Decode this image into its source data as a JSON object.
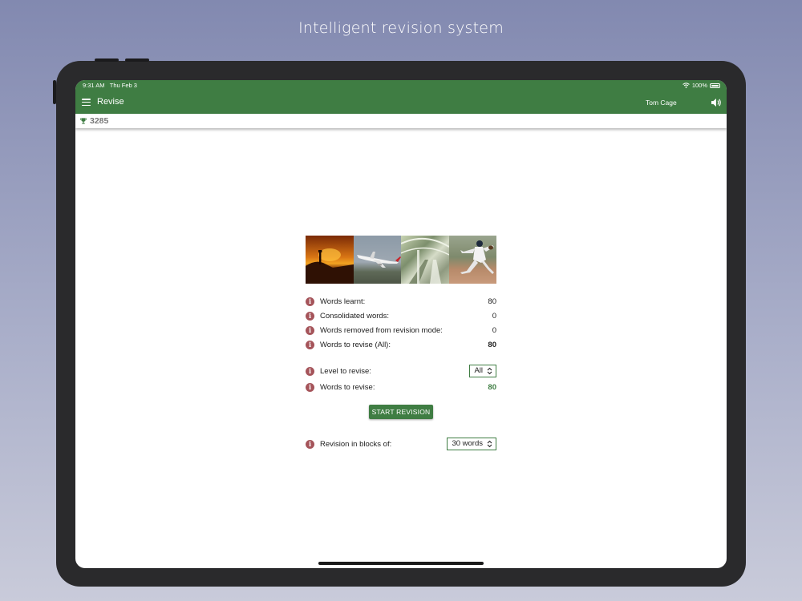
{
  "headline": "Intelligent revision system",
  "status_bar": {
    "time": "9:31 AM",
    "date": "Thu Feb 3",
    "battery": "100%"
  },
  "app_bar": {
    "title": "Revise",
    "user": "Tom Cage"
  },
  "score": "3285",
  "stats": {
    "words_learnt_label": "Words learnt:",
    "words_learnt_value": "80",
    "consolidated_label": "Consolidated words:",
    "consolidated_value": "0",
    "removed_label": "Words removed from revision mode:",
    "removed_value": "0",
    "to_revise_all_label": "Words to revise (All):",
    "to_revise_all_value": "80"
  },
  "level": {
    "label": "Level to revise:",
    "selected": "All"
  },
  "words_to_revise": {
    "label": "Words to revise:",
    "value": "80"
  },
  "start_button": "START REVISION",
  "blocks": {
    "label": "Revision in blocks of:",
    "selected": "30 words"
  },
  "colors": {
    "primary": "#3f7d43",
    "info_icon": "#a5545a"
  },
  "icons": {
    "menu": "hamburger-icon",
    "speaker": "speaker-icon",
    "trophy": "trophy-icon",
    "info": "info-icon",
    "wifi": "wifi-icon",
    "battery": "battery-icon"
  }
}
